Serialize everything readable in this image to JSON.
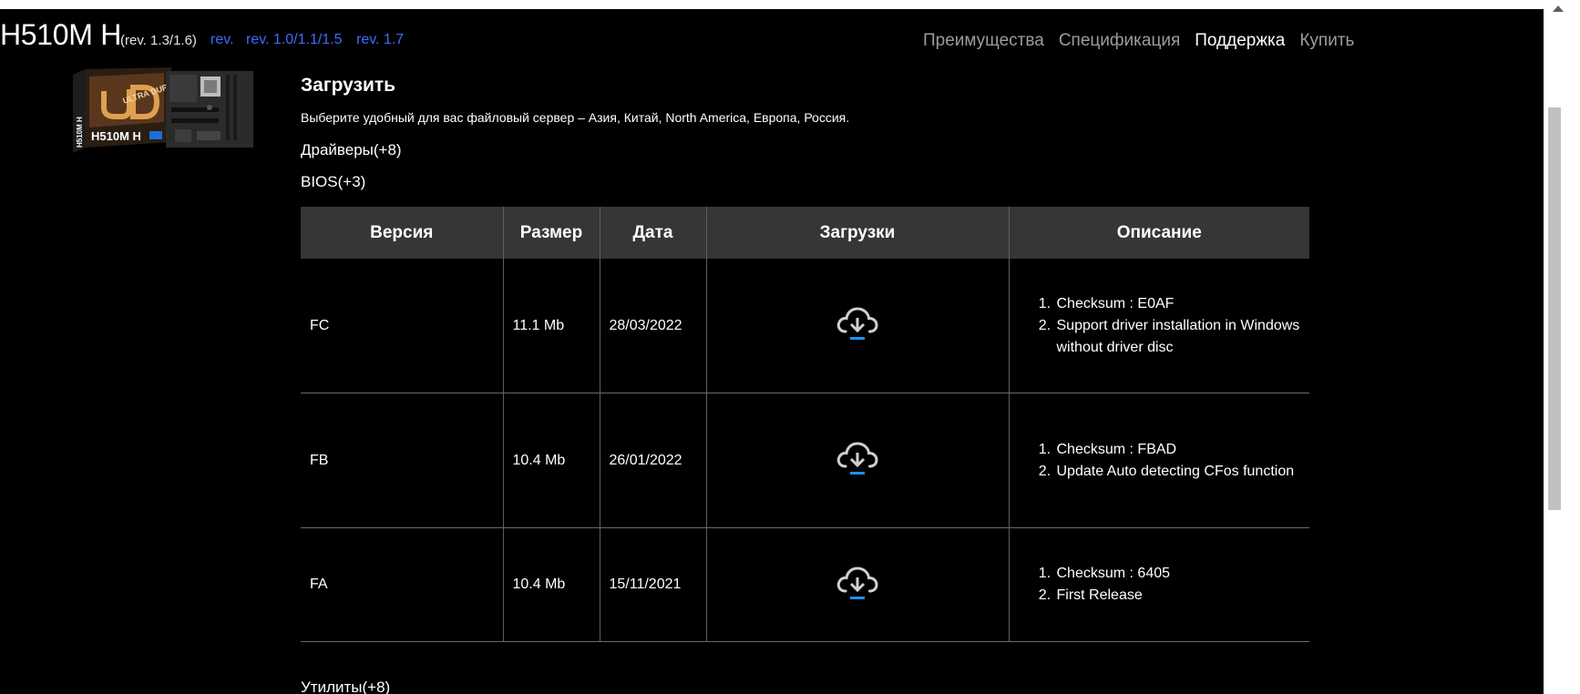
{
  "header": {
    "model": "H510M H",
    "revision_current": "(rev. 1.3/1.6)",
    "revision_links": [
      "rev.",
      "rev. 1.0/1.1/1.5",
      "rev. 1.7"
    ],
    "nav": [
      "Преимущества",
      "Спецификация",
      "Поддержка",
      "Купить"
    ],
    "nav_active": "Поддержка"
  },
  "product_image": {
    "label": "H510M H",
    "box_side_label": "H510M H",
    "logo_text": "ULTRA DURABLE"
  },
  "section": {
    "title": "Загрузить",
    "server_note": "Выберите удобный для вас файловый сервер – Азия, Китай, North America, Европа, Россия.",
    "categories": {
      "drivers": "Драйверы(+8)",
      "bios": "BIOS(+3)",
      "utilities": "Утилиты(+8)"
    }
  },
  "bios_table": {
    "columns": [
      "Версия",
      "Размер",
      "Дата",
      "Загрузки",
      "Описание"
    ],
    "rows": [
      {
        "version": "FC",
        "size": "11.1 Mb",
        "date": "28/03/2022",
        "download_icon": "cloud-download-icon",
        "description": [
          "Checksum : E0AF",
          "Support driver installation in Windows without driver disc"
        ]
      },
      {
        "version": "FB",
        "size": "10.4 Mb",
        "date": "26/01/2022",
        "download_icon": "cloud-download-icon",
        "description": [
          "Checksum : FBAD",
          "Update Auto detecting CFos function"
        ]
      },
      {
        "version": "FA",
        "size": "10.4 Mb",
        "date": "15/11/2021",
        "download_icon": "cloud-download-icon",
        "description": [
          "Checksum : 6405",
          "First Release"
        ]
      }
    ]
  },
  "colors": {
    "background": "#000000",
    "table_header": "#363636",
    "link": "#3d6cff",
    "nav_inactive": "#9c9c9c",
    "download_accent": "#1e90ff"
  }
}
